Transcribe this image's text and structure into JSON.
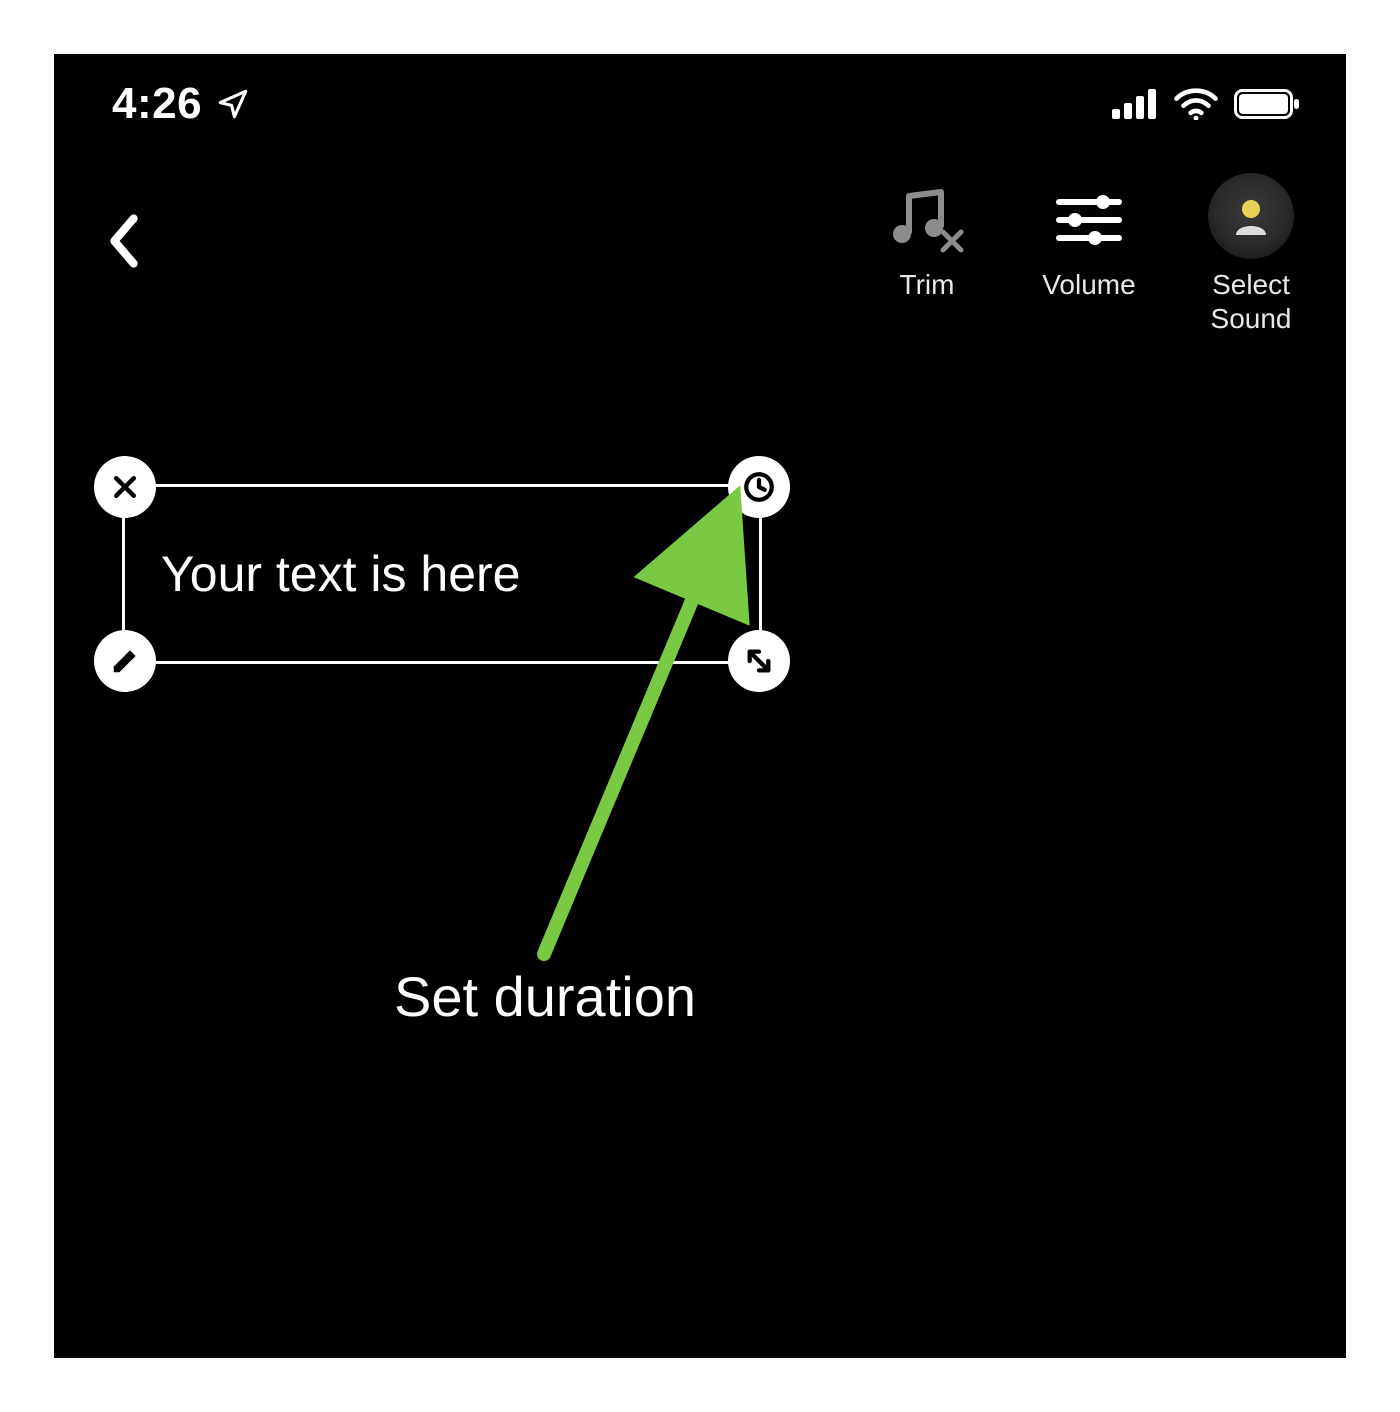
{
  "status": {
    "time": "4:26",
    "location_icon": "location-arrow-icon",
    "signal_icon": "cellular-signal-icon",
    "wifi_icon": "wifi-icon",
    "battery_icon": "battery-icon"
  },
  "header": {
    "back_icon": "chevron-left-icon",
    "tools": [
      {
        "name": "trim",
        "label": "Trim",
        "icon": "music-trim-icon"
      },
      {
        "name": "volume",
        "label": "Volume",
        "icon": "sliders-icon"
      },
      {
        "name": "select-sound",
        "label": "Select\nSound",
        "icon": "person-avatar-icon"
      }
    ]
  },
  "text_overlay": {
    "content": "Your text is here",
    "handles": {
      "top_left": {
        "name": "delete-handle",
        "icon": "close-icon"
      },
      "top_right": {
        "name": "duration-handle",
        "icon": "clock-icon"
      },
      "bottom_left": {
        "name": "edit-handle",
        "icon": "pencil-icon"
      },
      "bottom_right": {
        "name": "resize-handle",
        "icon": "resize-arrows-icon"
      }
    }
  },
  "annotation": {
    "label": "Set duration",
    "arrow_color": "#7ac943"
  }
}
